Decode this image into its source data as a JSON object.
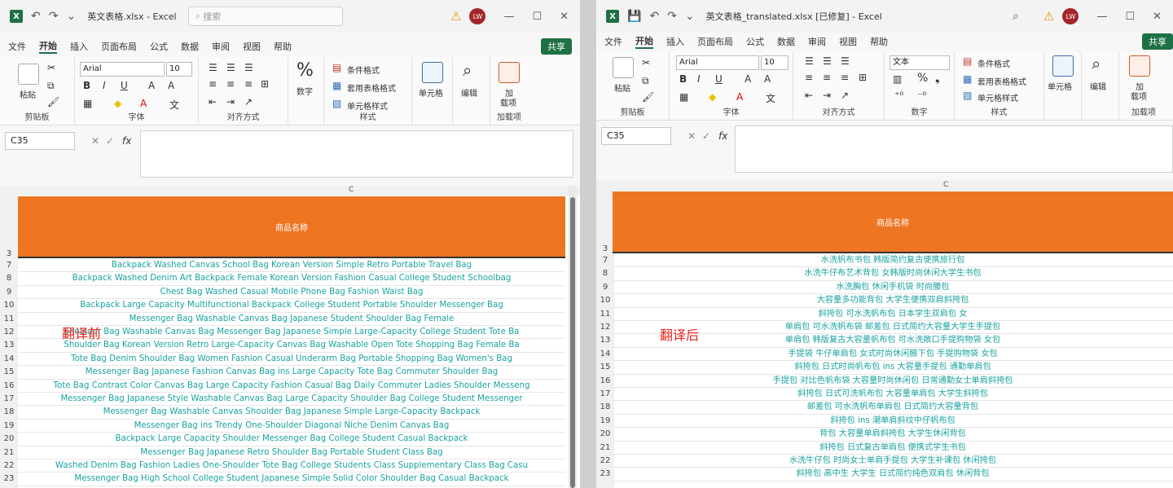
{
  "left": {
    "title": "英文表格.xlsx - Excel",
    "search_placeholder": "搜索",
    "avatar": "LW",
    "menu": [
      "文件",
      "开始",
      "插入",
      "页面布局",
      "公式",
      "数据",
      "审阅",
      "视图",
      "帮助"
    ],
    "share": "共享",
    "ribbon": {
      "paste": "粘贴",
      "clipboard": "剪贴板",
      "font_name": "Arial",
      "font_size": "10",
      "font": "字体",
      "alignment": "对齐方式",
      "number": "数字",
      "cond_format": "条件格式",
      "table_format": "套用表格格式",
      "cell_style": "单元格样式",
      "styles": "样式",
      "cells": "单元格",
      "editing": "编辑",
      "addins_top": "加",
      "addins_bottom": "载项",
      "addins": "加载项"
    },
    "namebox": "C35",
    "column": "C",
    "header_row": "3",
    "header_text": "商品名称",
    "label": "翻译前",
    "row_numbers": [
      "7",
      "8",
      "9",
      "10",
      "11",
      "12",
      "13",
      "14",
      "15",
      "16",
      "17",
      "18",
      "19",
      "20",
      "21",
      "22",
      "23"
    ],
    "rows": [
      "Backpack Washed Canvas School Bag Korean Version Simple Retro Portable Travel Bag",
      "Backpack Washed Denim Art Backpack Female Korean Version Fashion Casual College Student Schoolbag",
      "Chest Bag Washed Casual Mobile Phone Bag Fashion Waist Bag",
      "Backpack Large Capacity Multifunctional Backpack College Student Portable Shoulder Messenger Bag",
      "Messenger Bag Washable Canvas Bag Japanese Student Shoulder Bag Female",
      "Shoulder Bag Washable Canvas Bag Messenger Bag Japanese Simple Large-Capacity College Student Tote Ba",
      "Shoulder Bag Korean Version Retro Large-Capacity Canvas Bag Washable Open Tote Shopping Bag Female Ba",
      "Tote Bag Denim Shoulder Bag Women Fashion Casual Underarm Bag Portable Shopping Bag Women's Bag",
      "Messenger Bag Japanese Fashion Canvas Bag ins Large Capacity Tote Bag Commuter Shoulder Bag",
      "Tote Bag Contrast Color Canvas Bag Large Capacity Fashion Casual Bag Daily Commuter Ladies Shoulder Messeng",
      "Messenger Bag Japanese Style Washable Canvas Bag Large Capacity Shoulder Bag College Student Messenger",
      "Messenger Bag Washable Canvas Shoulder Bag Japanese Simple Large-Capacity Backpack",
      "Messenger Bag ins Trendy One-Shoulder Diagonal Niche Denim Canvas Bag",
      "Backpack Large Capacity Shoulder Messenger Bag College Student Casual Backpack",
      "Messenger Bag Japanese Retro Shoulder Bag Portable Student Class Bag",
      "Washed Denim Bag Fashion Ladies One-Shoulder Tote Bag College Students Class Supplementary Class Bag Casu",
      "Messenger Bag High School College Student Japanese Simple Solid Color Shoulder Bag Casual Backpack"
    ]
  },
  "right": {
    "title": "英文表格_translated.xlsx [已修复] - Excel",
    "avatar": "LW",
    "menu": [
      "文件",
      "开始",
      "插入",
      "页面布局",
      "公式",
      "数据",
      "审阅",
      "视图",
      "帮助"
    ],
    "share": "共享",
    "ribbon": {
      "paste": "粘贴",
      "clipboard": "剪贴板",
      "font_name": "Arial",
      "font_size": "10",
      "font": "字体",
      "alignment": "对齐方式",
      "number_format": "文本",
      "number": "数字",
      "cond_format": "条件格式",
      "table_format": "套用表格格式",
      "cell_style": "单元格样式",
      "styles": "样式",
      "cells": "单元格",
      "editing": "编辑",
      "addins_top": "加",
      "addins_bottom": "载项",
      "addins": "加载项"
    },
    "namebox": "C35",
    "column": "C",
    "header_row": "3",
    "header_text": "商品名称",
    "label": "翻译后",
    "row_numbers": [
      "7",
      "8",
      "9",
      "10",
      "11",
      "12",
      "13",
      "14",
      "15",
      "16",
      "17",
      "18",
      "19",
      "20",
      "21",
      "22",
      "23"
    ],
    "rows": [
      "水洗帆布书包 韩版简约复古便携旅行包",
      "水洗牛仔布艺术背包 女韩版时尚休闲大学生书包",
      "水洗胸包 休闲手机袋 时尚腰包",
      "大容量多功能背包 大学生便携双肩斜挎包",
      "斜挎包 可水洗帆布包 日本学生双肩包 女",
      "单肩包 可水洗帆布袋 邮差包 日式简约大容量大学生手提包",
      "单肩包 韩版复古大容量帆布包 可水洗敞口手提购物袋 女包",
      "手提袋 牛仔单肩包 女式时尚休闲腋下包 手提购物袋 女包",
      "斜挎包 日式时尚帆布包 ins 大容量手提包 通勤单肩包",
      "手提包 对比色帆布袋 大容量时尚休闲包 日常通勤女士单肩斜挎包",
      "斜挎包 日式可洗帆布包 大容量单肩包 大学生斜挎包",
      "邮差包 可水洗帆布单肩包 日式简约大容量背包",
      "斜挎包 ins 潮单肩斜纹中仔帆布包",
      "背包 大容量单肩斜挎包 大学生休闲背包",
      "斜挎包 日式复古单肩包 便携式学生书包",
      "水洗牛仔包 时尚女士单肩手提包 大学生补课包 休闲挎包",
      "斜挎包 高中生 大学生 日式简约纯色双肩包 休闲背包"
    ]
  }
}
